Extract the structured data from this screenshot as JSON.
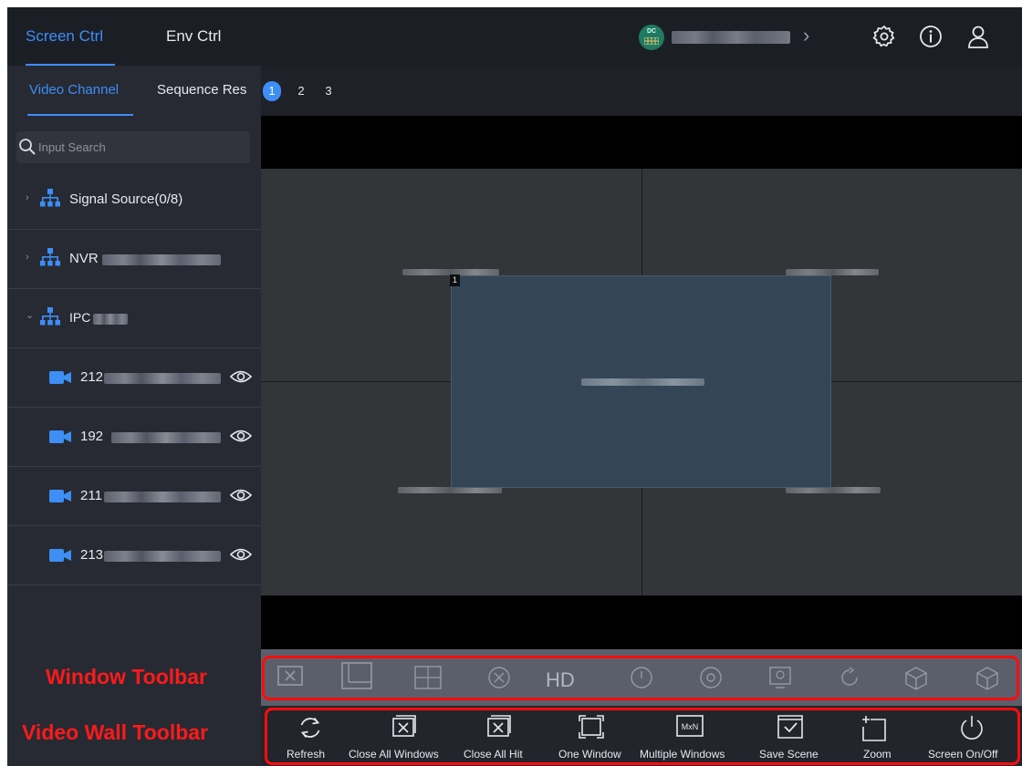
{
  "top_nav": {
    "tabs": [
      {
        "label": "Screen Ctrl",
        "active": true
      },
      {
        "label": "Env Ctrl",
        "active": false
      }
    ],
    "device_logo_text": "DC",
    "icons": [
      "settings-gear-icon",
      "info-icon",
      "user-icon"
    ]
  },
  "left_panel": {
    "subtabs": [
      {
        "label": "Video Channel",
        "active": true
      },
      {
        "label": "Sequence Res",
        "active": false
      }
    ],
    "search_placeholder": "Input Search",
    "tree": [
      {
        "label": "Signal Source(0/8)",
        "expanded": false,
        "type": "group"
      },
      {
        "label": "NVR",
        "expanded": false,
        "type": "group"
      },
      {
        "label": "IPC",
        "expanded": true,
        "type": "group"
      },
      {
        "label": "212",
        "type": "camera"
      },
      {
        "label": "192",
        "type": "camera"
      },
      {
        "label": "211",
        "type": "camera"
      },
      {
        "label": "213",
        "type": "camera"
      }
    ]
  },
  "pager": {
    "pages": [
      "1",
      "2",
      "3"
    ],
    "active_page": "1"
  },
  "wall": {
    "window_number": "1"
  },
  "window_toolbar": {
    "hd_label": "HD",
    "icons": [
      "close-window-icon",
      "split-window-icon",
      "grid-window-icon",
      "cancel-icon",
      "power-icon",
      "settings-icon",
      "monitor-icon",
      "refresh-icon",
      "cube-icon",
      "cube-outline-icon"
    ]
  },
  "video_wall_toolbar": {
    "buttons": [
      {
        "label": "Refresh",
        "icon": "refresh-icon"
      },
      {
        "label": "Close All Windows",
        "icon": "close-all-windows-icon"
      },
      {
        "label": "Close All Hit",
        "icon": "close-all-hit-icon"
      },
      {
        "label": "One Window",
        "icon": "one-window-icon"
      },
      {
        "label": "Multiple Windows",
        "icon": "multiple-windows-icon"
      },
      {
        "label": "Save Scene",
        "icon": "save-scene-icon"
      },
      {
        "label": "Zoom",
        "icon": "zoom-icon"
      },
      {
        "label": "Screen On/Off",
        "icon": "power-icon"
      }
    ],
    "mxn_text": "MxN"
  },
  "annotations": {
    "window_toolbar_label": "Window Toolbar",
    "video_wall_toolbar_label": "Video Wall Toolbar",
    "color": "#ff0d0d"
  },
  "colors": {
    "accent": "#3d8ef5",
    "background": "#1f2128",
    "panel": "#272a33",
    "window_fill": "#344558"
  }
}
